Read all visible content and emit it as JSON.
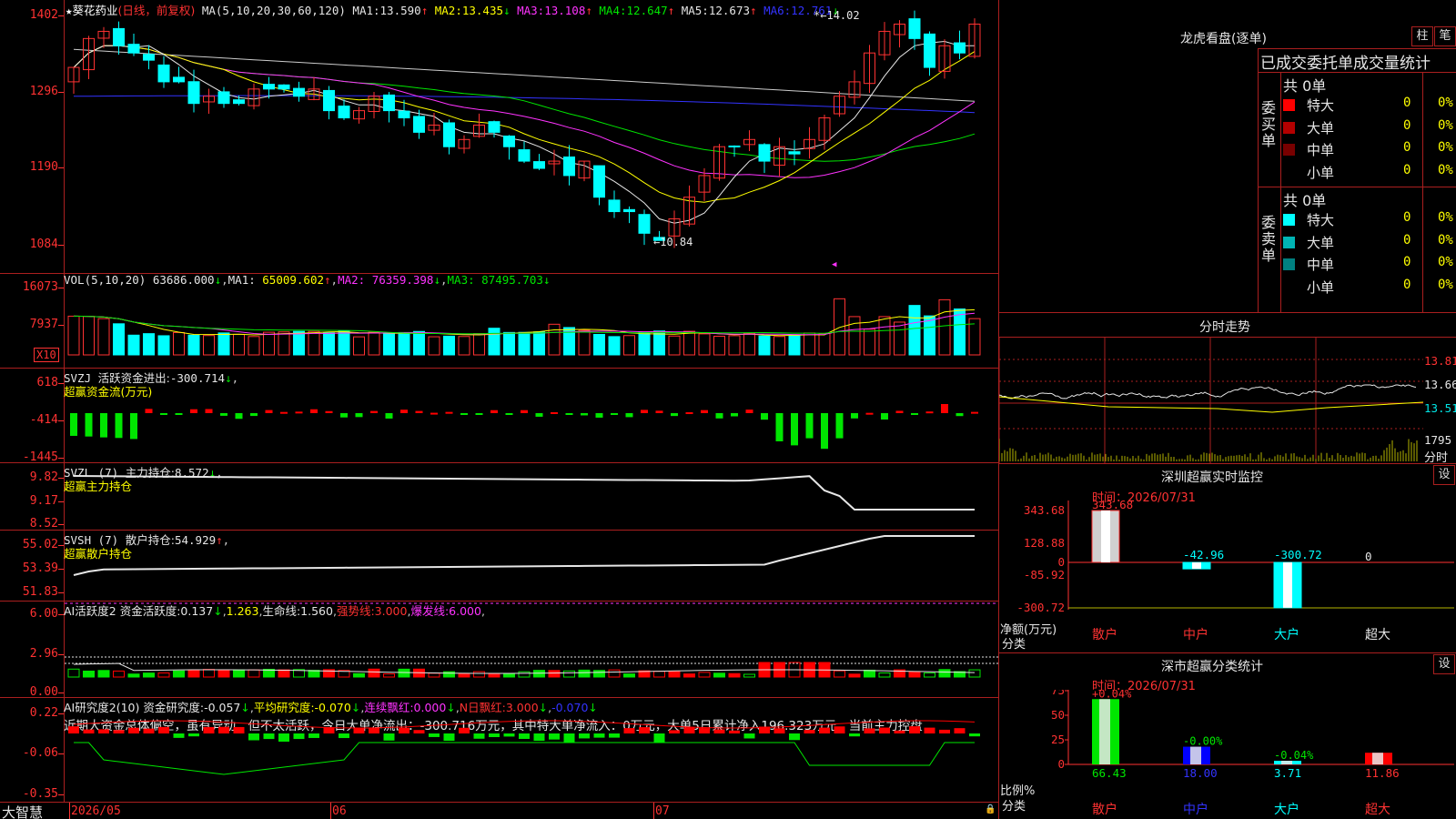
{
  "stock": {
    "name": "葵花药业",
    "mode": "(日线，前复权)",
    "star": "★"
  },
  "ma_header": {
    "label": "MA(5,10,20,30,60,120)",
    "items": [
      {
        "name": "MA1:",
        "value": "13.590",
        "arrow": "↑",
        "color": "#e6e6e6"
      },
      {
        "name": "MA2:",
        "value": "13.435",
        "arrow": "↓",
        "color": "#ffff00"
      },
      {
        "name": "MA3:",
        "value": "13.108",
        "arrow": "↑",
        "color": "#ff33ff"
      },
      {
        "name": "MA4:",
        "value": "12.647",
        "arrow": "↑",
        "color": "#00e600"
      },
      {
        "name": "MA5:",
        "value": "12.673",
        "arrow": "↑",
        "color": "#e6e6e6"
      },
      {
        "name": "MA6:",
        "value": "12.761",
        "arrow": "↓",
        "color": "#3333ff"
      }
    ]
  },
  "price_axis": [
    "1402",
    "1296",
    "1190",
    "1084"
  ],
  "price_marks": {
    "high": "14.02",
    "low": "10.84"
  },
  "vol": {
    "label": "VOL(5,10,20)",
    "value": "63686.000",
    "arrow": "↓",
    "ma1": "65009.602",
    "ma1a": "↑",
    "ma2": "76359.398",
    "ma2a": "↓",
    "ma3": "87495.703",
    "ma3a": "↓",
    "axis": [
      "16073",
      "7937"
    ],
    "unit": "X10"
  },
  "svzj": {
    "label": "SVZJ",
    "desc": "活跃资金进出:",
    "value": "-300.714",
    "arrow": "↓",
    "title": "超赢资金流(万元)",
    "axis": [
      "618",
      "-414",
      "-1445"
    ]
  },
  "svzl": {
    "label": "SVZL (7)",
    "desc": "主力持仓:",
    "value": "8.572",
    "arrow": "↓",
    "title": "超赢主力持仓",
    "axis": [
      "9.82",
      "9.17",
      "8.52"
    ]
  },
  "svsh": {
    "label": "SVSH (7)",
    "desc": "散户持仓:",
    "value": "54.929",
    "arrow": "↑",
    "title": "超赢散户持仓",
    "axis": [
      "55.02",
      "53.39",
      "51.83"
    ]
  },
  "ai_act": {
    "label": "AI活跃度2",
    "desc": "资金活跃度:",
    "v1": "0.137",
    "a1": "↓",
    "v2": "1.263",
    "life": "生命线:",
    "life_v": "1.560",
    "strong": "强势线:",
    "strong_v": "3.000",
    "burst": "爆发线:",
    "burst_v": "6.000",
    "axis": [
      "6.00",
      "2.96",
      "0.00"
    ]
  },
  "ai_res": {
    "label": "AI研究度2(10)",
    "desc": "资金研究度:",
    "v": "-0.057",
    "a": "↓",
    "avg": "平均研究度:",
    "avg_v": "-0.070",
    "avg_a": "↓",
    "lian": "连续飘红:",
    "lian_v": "0.000",
    "lian_a": "↓",
    "nday": "N日飘红:",
    "nday_v": "3.000",
    "nday_a": "↓",
    "last": "-0.070",
    "last_a": "↓",
    "axis": [
      "0.22",
      "-0.06",
      "-0.35"
    ],
    "comment": "近期大资金总体偏空，虽有异动，但不太活跃，今日大单净流出：-300.716万元，其中特大单净流入：0万元，大单5日累计净入196.323万元，当前主力控盘"
  },
  "xaxis": {
    "brand": "大智慧",
    "labels": [
      "2026/05",
      "06",
      "07"
    ]
  },
  "right": {
    "dragon_title": "龙虎看盘(逐单)",
    "btn_zhu": "柱",
    "btn_bi": "笔",
    "stats_title": "已成交委托单成交量统计",
    "buy": {
      "side": "委买单",
      "total": "共 0单",
      "rows": [
        {
          "name": "特大",
          "n": "0",
          "p": "0%",
          "color": "#ff0000"
        },
        {
          "name": "大单",
          "n": "0",
          "p": "0%",
          "color": "#b40000"
        },
        {
          "name": "中单",
          "n": "0",
          "p": "0%",
          "color": "#780000"
        },
        {
          "name": "小单",
          "n": "0",
          "p": "0%",
          "color": "#000000"
        }
      ]
    },
    "sell": {
      "side": "委卖单",
      "total": "共 0单",
      "rows": [
        {
          "name": "特大",
          "n": "0",
          "p": "0%",
          "color": "#00ffff"
        },
        {
          "name": "大单",
          "n": "0",
          "p": "0%",
          "color": "#00b4b4"
        },
        {
          "name": "中单",
          "n": "0",
          "p": "0%",
          "color": "#008080"
        },
        {
          "name": "小单",
          "n": "0",
          "p": "0%",
          "color": "#000000"
        }
      ]
    },
    "intraday": {
      "title": "分时走势",
      "axis": [
        "13.81",
        "13.66",
        "13.51",
        "1795"
      ],
      "label": "分时"
    },
    "monitor": {
      "title": "深圳超赢实时监控",
      "btn": "设",
      "time": "时间：2026/07/31",
      "axis": [
        "343.68",
        "128.88",
        "0",
        "-85.92",
        "-300.72"
      ],
      "ylabel": "净额(万元)",
      "xlabel": "分类",
      "bars": [
        {
          "cat": "散户",
          "value": 343.68,
          "label": "343.68"
        },
        {
          "cat": "中户",
          "value": -42.96,
          "label": "-42.96"
        },
        {
          "cat": "大户",
          "value": -300.72,
          "label": "-300.72"
        },
        {
          "cat": "超大",
          "value": 0,
          "label": "0"
        }
      ]
    },
    "classify": {
      "title": "深市超赢分类统计",
      "btn": "设",
      "time": "时间：2026/07/31",
      "axis": [
        "75",
        "50",
        "25",
        "0"
      ],
      "ylabel": "比例%",
      "xlabel": "分类",
      "bars": [
        {
          "cat": "散户",
          "value": 66.43,
          "label": "66.43",
          "chg": "+0.04%",
          "color": "#00e600"
        },
        {
          "cat": "中户",
          "value": 18.0,
          "label": "18.00",
          "chg": "-0.00%",
          "color": "#0000ff"
        },
        {
          "cat": "大户",
          "value": 3.71,
          "label": "3.71",
          "chg": "-0.04%",
          "color": "#00ffff"
        },
        {
          "cat": "超大",
          "value": 11.86,
          "label": "11.86",
          "chg": "",
          "color": "#ff0000"
        }
      ]
    }
  }
}
